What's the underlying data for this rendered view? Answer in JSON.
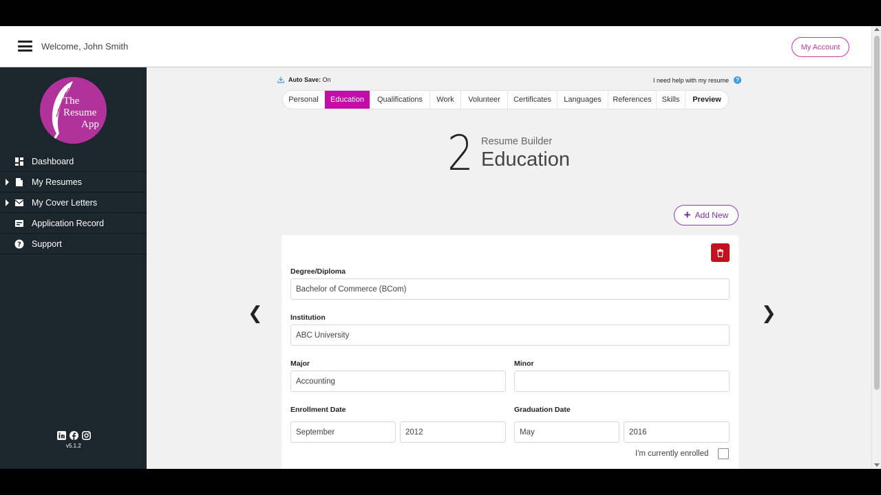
{
  "header": {
    "welcome": "Welcome, John Smith",
    "account_label": "My Account"
  },
  "logo": {
    "line1": "The",
    "line2": "Resume",
    "line3": "App"
  },
  "sidebar": {
    "items": [
      {
        "label": "Dashboard",
        "icon": "grid-icon",
        "expandable": false
      },
      {
        "label": "My Resumes",
        "icon": "document-icon",
        "expandable": true
      },
      {
        "label": "My Cover Letters",
        "icon": "envelope-icon",
        "expandable": true
      },
      {
        "label": "Application Record",
        "icon": "card-icon",
        "expandable": false
      },
      {
        "label": "Support",
        "icon": "question-icon",
        "expandable": false
      }
    ],
    "version": "v5.1.2"
  },
  "toolbar_top": {
    "autosave_label": "Auto Save:",
    "autosave_value": "On",
    "help_text": "I need help with my resume"
  },
  "tabs": [
    {
      "label": "Personal"
    },
    {
      "label": "Education"
    },
    {
      "label": "Qualifications"
    },
    {
      "label": "Work"
    },
    {
      "label": "Volunteer"
    },
    {
      "label": "Certificates"
    },
    {
      "label": "Languages"
    },
    {
      "label": "References"
    },
    {
      "label": "Skills"
    },
    {
      "label": "Preview"
    }
  ],
  "step": {
    "number": "2",
    "subtitle": "Resume Builder",
    "title": "Education"
  },
  "add_new_label": "Add New",
  "form": {
    "degree_label": "Degree/Diploma",
    "degree_value": "Bachelor of Commerce (BCom)",
    "institution_label": "Institution",
    "institution_value": "ABC University",
    "major_label": "Major",
    "major_value": "Accounting",
    "minor_label": "Minor",
    "minor_value": "",
    "enroll_label": "Enrollment Date",
    "enroll_month": "September",
    "enroll_year": "2012",
    "grad_label": "Graduation Date",
    "grad_month": "May",
    "grad_year": "2016",
    "enrolled_label": "I'm currently enrolled"
  },
  "colors": {
    "accent": "#c40ca8",
    "sidebar_bg": "#1c262d",
    "delete": "#c0131f"
  }
}
